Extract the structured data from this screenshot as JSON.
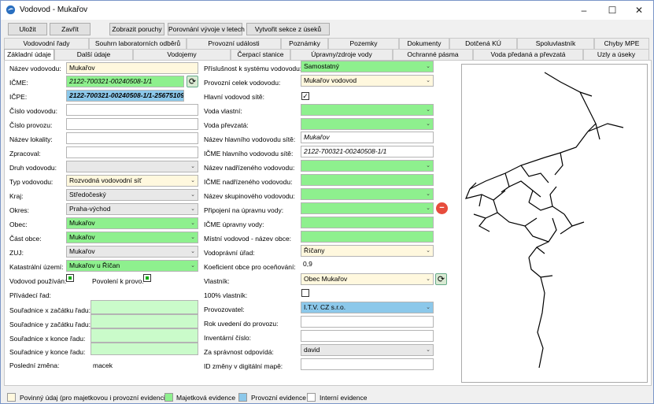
{
  "window": {
    "title": "Vodovod - Mukařov",
    "minimize": "–",
    "maximize": "☐",
    "close": "✕"
  },
  "toolbar": {
    "save": "Uložit",
    "close": "Zavřít",
    "show_faults": "Zobrazit poruchy",
    "compare": "Porovnání vývoje v letech",
    "create_sections": "Vytvořit sekce z úseků"
  },
  "tabs_row1": [
    "Vodovodní řady",
    "Souhrn laboratorních odběrů",
    "Provozní události",
    "Poznámky",
    "Pozemky",
    "Dokumenty",
    "Dotčená KÚ",
    "Spoluvlastník",
    "Chyby MPE"
  ],
  "tabs_row2": [
    "Základní údaje",
    "Další údaje",
    "Vodojemy",
    "Čerpací stanice",
    "Úpravny/zdroje vody",
    "Ochranné pásma",
    "Voda předaná a převzatá",
    "Uzly a úseky"
  ],
  "left": {
    "nazev_label": "Název vodovodu:",
    "nazev": "Mukařov",
    "icme_label": "IČME:",
    "icme": "2122-700321-00240508-1/1",
    "icpe_label": "IČPE:",
    "icpe": "2122-700321-00240508-1/1-25675109",
    "cislo_vod_label": "Číslo vodovodu:",
    "cislo_vod": "",
    "cislo_prov_label": "Číslo provozu:",
    "cislo_prov": "",
    "lokalita_label": "Název lokality:",
    "lokalita": "",
    "zpracoval_label": "Zpracoval:",
    "zpracoval": "",
    "druh_label": "Druh vodovodu:",
    "druh": "",
    "typ_label": "Typ vodovodu:",
    "typ": "Rozvodná vodovodní síť",
    "kraj_label": "Kraj:",
    "kraj": "Středočeský",
    "okres_label": "Okres:",
    "okres": "Praha-východ",
    "obec_label": "Obec:",
    "obec": "Mukařov",
    "cast_label": "Část obce:",
    "cast": "Mukařov",
    "zuj_label": "ZUJ:",
    "zuj": "Mukařov",
    "kat_label": "Katastrální území:",
    "kat": "Mukařov u Říčan",
    "pouzivan_label": "Vodovod používán:",
    "povoleni_label": "Povolení k provo.",
    "privadeci_label": "Přívádecí řad:",
    "sx_start_label": "Souřadnice x začátku řadu:",
    "sy_start_label": "Souřadnice y začátku řadu:",
    "sx_end_label": "Souřadnice x konce řadu:",
    "sy_end_label": "Souřadnice y konce řadu:",
    "last_change_label": "Poslední změna:",
    "last_change": "macek"
  },
  "mid": {
    "prislusnost_label": "Příslušnost k systému vodovodu:",
    "prislusnost": "Samostatný",
    "celek_label": "Provozní celek vodovodu:",
    "celek": "Mukařov vodovod",
    "hlavni_label": "Hlavní vodovod sítě:",
    "vlastni_label": "Voda vlastní:",
    "prevzata_label": "Voda převzatá:",
    "nazev_hl_label": "Název hlavního vodovodu sítě:",
    "nazev_hl": "Mukařov",
    "icme_hl_label": "IČME hlavního vodovodu sítě:",
    "icme_hl": "2122-700321-00240508-1/1",
    "nadr_label": "Název nadřízeného vodovodu:",
    "icme_nadr_label": "IČME nadřízeného vodovodu:",
    "skup_label": "Název skupinového vodovodu:",
    "pripojeni_label": "Připojení na úpravnu vody:",
    "icme_upr_label": "IČME úpravny vody:",
    "mistni_label": "Místní vodovod - název obce:",
    "urad_label": "Vodoprávní úřad:",
    "urad": "Říčany",
    "koef_label": "Koeficient obce pro oceňování:",
    "koef": "0,9",
    "vlastnik_label": "Vlastník:",
    "vlastnik": "Obec Mukařov",
    "vlastnik100_label": "100% vlastník:",
    "provozovatel_label": "Provozovatel:",
    "provozovatel": "I.T.V. CZ s.r.o.",
    "rok_label": "Rok uvedení do provozu:",
    "inv_label": "Inventární číslo:",
    "spravnost_label": "Za správnost odpovídá:",
    "spravnost": "david",
    "id_label": "ID změny v digitální mapě:"
  },
  "legend": {
    "mandatory": "Povinný údaj (pro majetkovou i provozní evidenci)",
    "property": "Majetková evidence",
    "operational": "Provozní evidence",
    "internal": "Interní evidence"
  },
  "colors": {
    "mandatory": "#fff8de",
    "property": "#8ef08e",
    "operational": "#8cc8ea",
    "internal": "#ffffff"
  },
  "icons": [
    "droplet-icon",
    "refresh-icon",
    "remove-icon",
    "chevron-down-icon",
    "checkmark-icon"
  ]
}
